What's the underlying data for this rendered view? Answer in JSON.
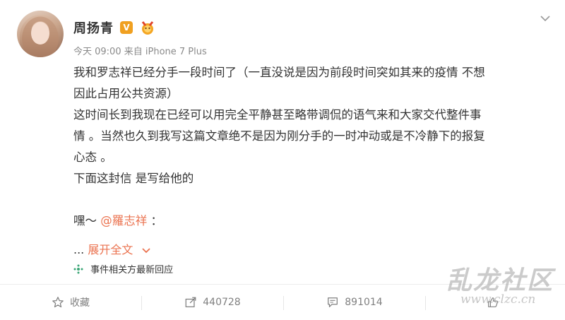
{
  "user": {
    "name": "周扬青",
    "vip_badge": "V"
  },
  "meta": {
    "time": "今天 09:00",
    "source": "来自 iPhone 7 Plus"
  },
  "post": {
    "lines": [
      "我和罗志祥已经分手一段时间了（一直没说是因为前段时间突如其来的疫情 不想",
      "因此占用公共资源）",
      "这时间长到我现在已经可以用完全平静甚至略带调侃的语气来和大家交代整件事",
      "情 。当然也久到我写这篇文章绝不是因为刚分手的一时冲动或是不冷静下的报复",
      "心态 。",
      "下面这封信 是写给他的"
    ],
    "greeting_prefix": "嘿～",
    "mention": "@羅志祥",
    "greeting_suffix": "："
  },
  "expand": {
    "ellipsis": "...",
    "label": "展开全文"
  },
  "related": {
    "label": "事件相关方最新回应"
  },
  "actions": {
    "favorite": "收藏",
    "repost": "440728",
    "comment": "891014"
  },
  "watermark": {
    "text": "乱龙社区",
    "url": "www.clzc.cn"
  },
  "colors": {
    "accent": "#eb7350",
    "vip": "#f0a020",
    "text": "#333333",
    "muted": "#808080"
  }
}
